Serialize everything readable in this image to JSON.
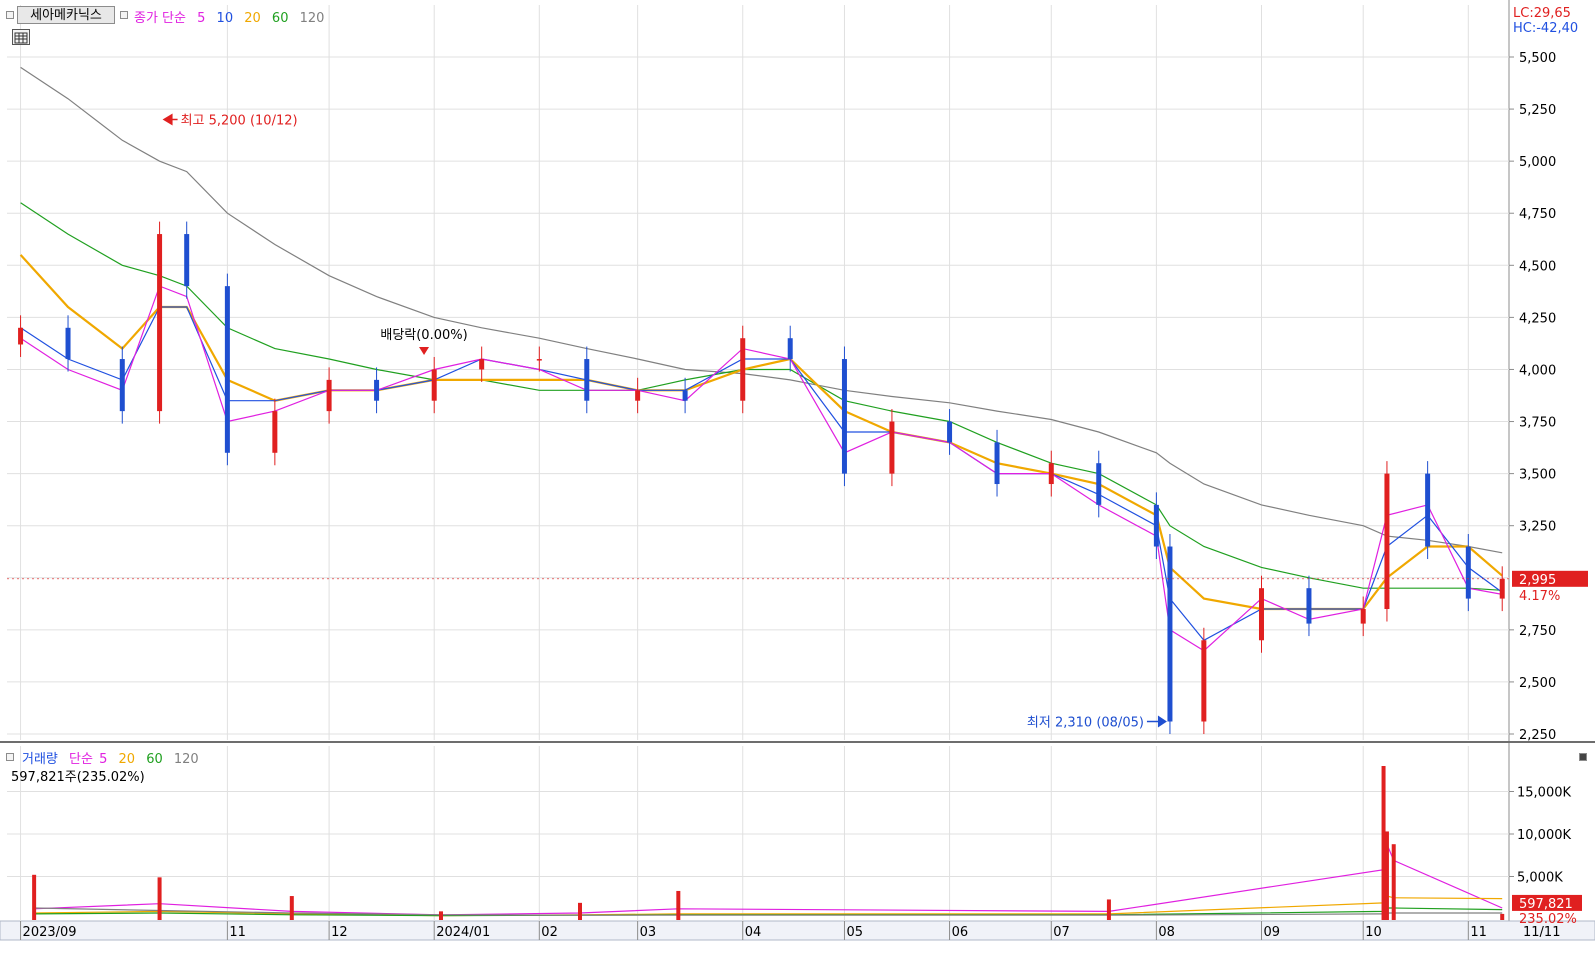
{
  "stock_name": "세아메카닉스",
  "price_legend": {
    "label": "종가 단순",
    "ma": [
      {
        "label": "5",
        "color": "#e020e0"
      },
      {
        "label": "10",
        "color": "#2050e0"
      },
      {
        "label": "20",
        "color": "#f0a800"
      },
      {
        "label": "60",
        "color": "#20a020"
      },
      {
        "label": "120",
        "color": "#808080"
      }
    ]
  },
  "header_right": {
    "lc": "LC:29,65",
    "hc": "HC:-42,40"
  },
  "annotations": {
    "high": "최고 5,200 (10/12)",
    "low": "최저 2,310 (08/05)",
    "dividend": "배당락(0.00%)"
  },
  "current_price": {
    "value": "2,995",
    "change": "4.17%"
  },
  "volume_legend": {
    "label": "거래량",
    "sub": "단순",
    "ma": [
      {
        "label": "5",
        "color": "#e020e0"
      },
      {
        "label": "20",
        "color": "#f0a800"
      },
      {
        "label": "60",
        "color": "#20a020"
      },
      {
        "label": "120",
        "color": "#808080"
      }
    ],
    "current": "597,821주(235.02%)"
  },
  "current_volume": {
    "value": "597,821",
    "ratio": "235.02%"
  },
  "x_tick_labels": [
    "2023/09",
    "11",
    "12",
    "2024/01",
    "02",
    "03",
    "04",
    "05",
    "06",
    "07",
    "08",
    "09",
    "10",
    "11"
  ],
  "right_date": "11/11",
  "colors": {
    "up": "#e02020",
    "down": "#1f4fd0",
    "grid": "#e0e0e0"
  },
  "chart_data": [
    {
      "type": "candlestick",
      "title": "세아메카닉스",
      "y_unit": "KRW",
      "ylim": [
        2250,
        5500
      ],
      "yticks": [
        "5,500",
        "5,250",
        "5,000",
        "4,750",
        "4,500",
        "4,250",
        "4,000",
        "3,750",
        "3,500",
        "3,250",
        "2,750",
        "2,500",
        "2,250"
      ],
      "ytick_values": [
        5500,
        5250,
        5000,
        4750,
        4500,
        4250,
        4000,
        3750,
        3500,
        3250,
        2750,
        2500,
        2250
      ],
      "grid": true,
      "series": [
        {
          "name": "종가",
          "x": [
            "2023-09-01",
            "2023-09-15",
            "2023-10-01",
            "2023-10-12",
            "2023-10-20",
            "2023-11-01",
            "2023-11-15",
            "2023-12-01",
            "2023-12-15",
            "2024-01-01",
            "2024-01-15",
            "2024-02-01",
            "2024-02-15",
            "2024-03-01",
            "2024-03-15",
            "2024-04-01",
            "2024-04-15",
            "2024-05-01",
            "2024-05-15",
            "2024-06-01",
            "2024-06-15",
            "2024-07-01",
            "2024-07-15",
            "2024-08-01",
            "2024-08-05",
            "2024-08-15",
            "2024-09-01",
            "2024-09-15",
            "2024-10-01",
            "2024-10-08",
            "2024-10-20",
            "2024-11-01",
            "2024-11-11"
          ],
          "values": [
            4200,
            4050,
            3800,
            4650,
            4400,
            3600,
            3800,
            3950,
            3850,
            4000,
            4050,
            4050,
            3850,
            3900,
            3850,
            4150,
            4050,
            3500,
            3750,
            3650,
            3450,
            3550,
            3350,
            3150,
            2310,
            2700,
            2950,
            2780,
            2850,
            3500,
            3150,
            2900,
            2995
          ]
        },
        {
          "name": "5",
          "values": [
            4150,
            4000,
            3900,
            4400,
            4350,
            3750,
            3800,
            3900,
            3900,
            4000,
            4050,
            4000,
            3900,
            3900,
            3850,
            4100,
            4050,
            3600,
            3700,
            3650,
            3500,
            3500,
            3350,
            3200,
            2750,
            2650,
            2900,
            2800,
            2850,
            3300,
            3350,
            2950,
            2920
          ]
        },
        {
          "name": "10",
          "values": [
            4200,
            4050,
            3950,
            4300,
            4300,
            3850,
            3850,
            3900,
            3900,
            3950,
            4050,
            4000,
            3950,
            3900,
            3900,
            4050,
            4050,
            3700,
            3700,
            3650,
            3500,
            3500,
            3400,
            3250,
            2900,
            2700,
            2850,
            2850,
            2850,
            3150,
            3300,
            3050,
            2930
          ]
        },
        {
          "name": "20",
          "values": [
            4550,
            4300,
            4100,
            4300,
            4300,
            3950,
            3850,
            3900,
            3900,
            3950,
            3950,
            3950,
            3950,
            3900,
            3900,
            4000,
            4050,
            3800,
            3700,
            3650,
            3550,
            3500,
            3450,
            3300,
            3050,
            2900,
            2850,
            2850,
            2850,
            3000,
            3150,
            3150,
            3010
          ]
        },
        {
          "name": "60",
          "values": [
            4800,
            4650,
            4500,
            4450,
            4400,
            4200,
            4100,
            4050,
            4000,
            3950,
            3950,
            3900,
            3900,
            3900,
            3950,
            4000,
            4000,
            3850,
            3800,
            3750,
            3650,
            3550,
            3500,
            3350,
            3250,
            3150,
            3050,
            3000,
            2950,
            2950,
            2950,
            2950,
            2940
          ]
        },
        {
          "name": "120",
          "values": [
            5450,
            5300,
            5100,
            5000,
            4950,
            4750,
            4600,
            4450,
            4350,
            4250,
            4200,
            4150,
            4100,
            4050,
            4000,
            3980,
            3950,
            3900,
            3870,
            3840,
            3800,
            3760,
            3700,
            3600,
            3550,
            3450,
            3350,
            3300,
            3250,
            3200,
            3180,
            3150,
            3120
          ]
        }
      ]
    },
    {
      "type": "bar",
      "title": "거래량",
      "ylim": [
        0,
        18500000
      ],
      "yticks": [
        "15,000K",
        "10,000K",
        "5,000K"
      ],
      "ytick_values": [
        15000000,
        10000000,
        5000000
      ],
      "grid": true,
      "series": [
        {
          "name": "거래량",
          "x": [
            "2023-09-05",
            "2023-10-12",
            "2023-11-20",
            "2024-01-03",
            "2024-02-13",
            "2024-03-13",
            "2024-07-18",
            "2024-10-07",
            "2024-10-08",
            "2024-10-10",
            "2024-11-11"
          ],
          "values": [
            5200000,
            4900000,
            2700000,
            900000,
            1900000,
            3300000,
            2300000,
            18000000,
            10300000,
            8800000,
            597821
          ]
        },
        {
          "name": "5",
          "values": [
            1200000,
            1800000,
            900000,
            500000,
            700000,
            1200000,
            900000,
            5800000,
            8800000,
            6900000,
            1300000
          ]
        },
        {
          "name": "20",
          "values": [
            700000,
            900000,
            600000,
            400000,
            500000,
            600000,
            600000,
            1900000,
            2700000,
            2500000,
            2400000
          ]
        },
        {
          "name": "60",
          "values": [
            600000,
            700000,
            500000,
            400000,
            450000,
            500000,
            500000,
            900000,
            1300000,
            1300000,
            1100000
          ]
        },
        {
          "name": "120",
          "values": [
            1300000,
            1000000,
            700000,
            500000,
            450000,
            450000,
            450000,
            600000,
            700000,
            700000,
            700000
          ]
        }
      ]
    }
  ]
}
